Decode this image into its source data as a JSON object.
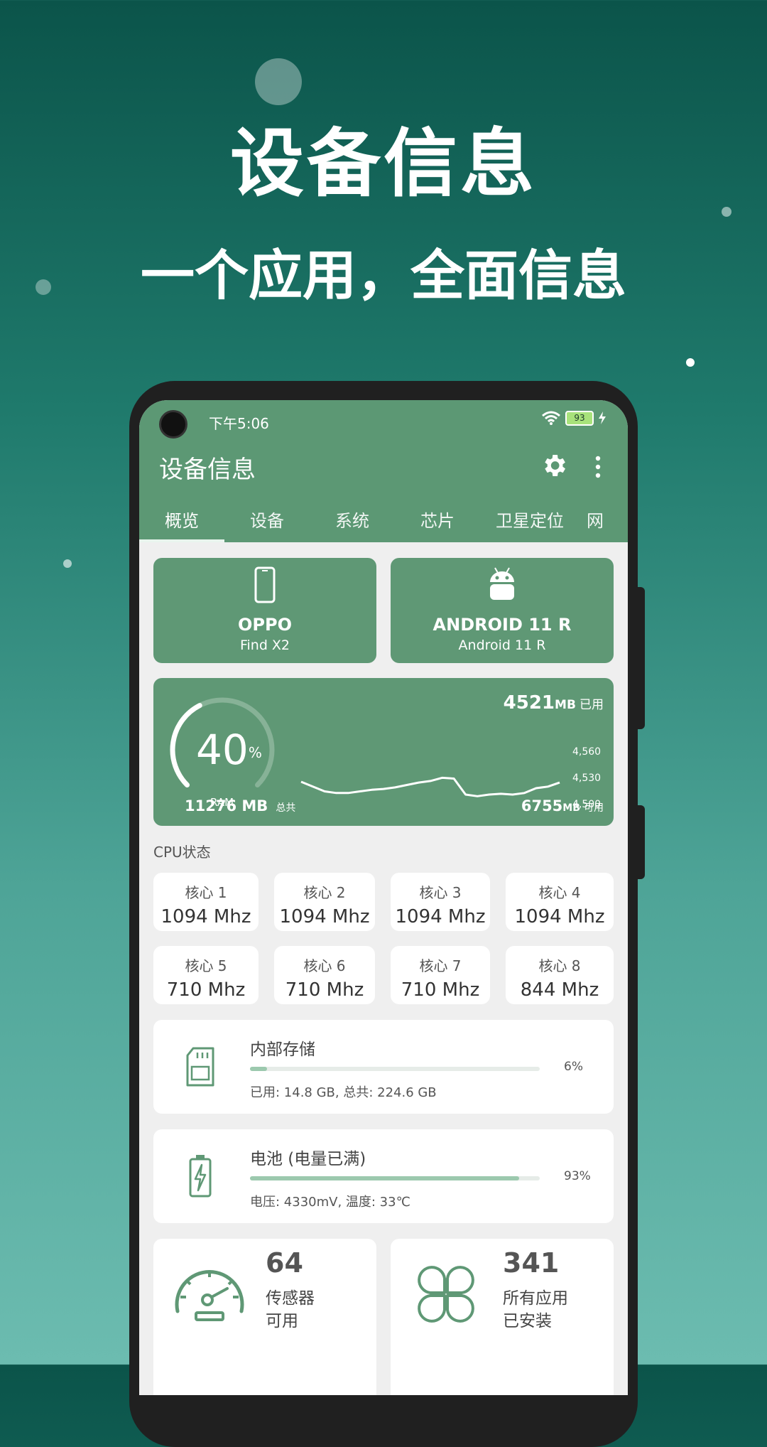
{
  "promo": {
    "title": "设备信息",
    "subtitle": "一个应用，全面信息"
  },
  "status_bar": {
    "time": "下午5:06",
    "battery_level": "93",
    "icons": [
      "wifi-icon",
      "battery-icon",
      "charging-bolt-icon"
    ]
  },
  "app_bar": {
    "title": "设备信息",
    "icons": [
      "gear-icon",
      "more-vert-icon"
    ]
  },
  "tabs": [
    {
      "label": "概览",
      "active": true
    },
    {
      "label": "设备",
      "active": false
    },
    {
      "label": "系统",
      "active": false
    },
    {
      "label": "芯片",
      "active": false
    },
    {
      "label": "卫星定位",
      "active": false
    },
    {
      "label": "网",
      "active": false
    }
  ],
  "device_card": {
    "icon": "phone-icon",
    "brand": "OPPO",
    "model": "Find X2"
  },
  "os_card": {
    "icon": "android-icon",
    "name": "ANDROID 11 R",
    "version": "Android 11 R"
  },
  "ram": {
    "percent": "40",
    "percent_sign": "%",
    "gauge_label": "RAM",
    "gauge_fraction": 0.4,
    "used_value": "4521",
    "used_unit": "MB",
    "used_label": "已用",
    "total_value": "11276 MB",
    "total_label": "总共",
    "available_value": "6755",
    "available_unit": "MB",
    "available_label": "可用",
    "chart_ticks": [
      "4,560",
      "4,530",
      "4,500"
    ],
    "chart_values": [
      4522,
      4516,
      4510,
      4508,
      4508,
      4510,
      4512,
      4513,
      4515,
      4518,
      4521,
      4523,
      4527,
      4526,
      4506,
      4504,
      4506,
      4507,
      4506,
      4508,
      4514,
      4516,
      4521
    ]
  },
  "cpu": {
    "title": "CPU状态",
    "cores": [
      {
        "label": "核心 1",
        "value": "1094 Mhz"
      },
      {
        "label": "核心 2",
        "value": "1094 Mhz"
      },
      {
        "label": "核心 3",
        "value": "1094 Mhz"
      },
      {
        "label": "核心 4",
        "value": "1094 Mhz"
      },
      {
        "label": "核心 5",
        "value": "710 Mhz"
      },
      {
        "label": "核心 6",
        "value": "710 Mhz"
      },
      {
        "label": "核心 7",
        "value": "710 Mhz"
      },
      {
        "label": "核心 8",
        "value": "844 Mhz"
      }
    ]
  },
  "storage": {
    "icon": "sd-card-icon",
    "title": "内部存储",
    "percent": "6%",
    "fraction": 0.06,
    "detail": "已用: 14.8 GB,  总共: 224.6 GB"
  },
  "battery_card": {
    "icon": "battery-charging-icon",
    "title": "电池 (电量已满)",
    "percent": "93%",
    "fraction": 0.93,
    "detail": "电压: 4330mV,  温度: 33℃"
  },
  "sensors": {
    "icon": "speedometer-icon",
    "count": "64",
    "line1": "传感器",
    "line2": "可用"
  },
  "apps": {
    "icon": "apps-clover-icon",
    "count": "341",
    "line1": "所有应用",
    "line2": "已安装"
  }
}
